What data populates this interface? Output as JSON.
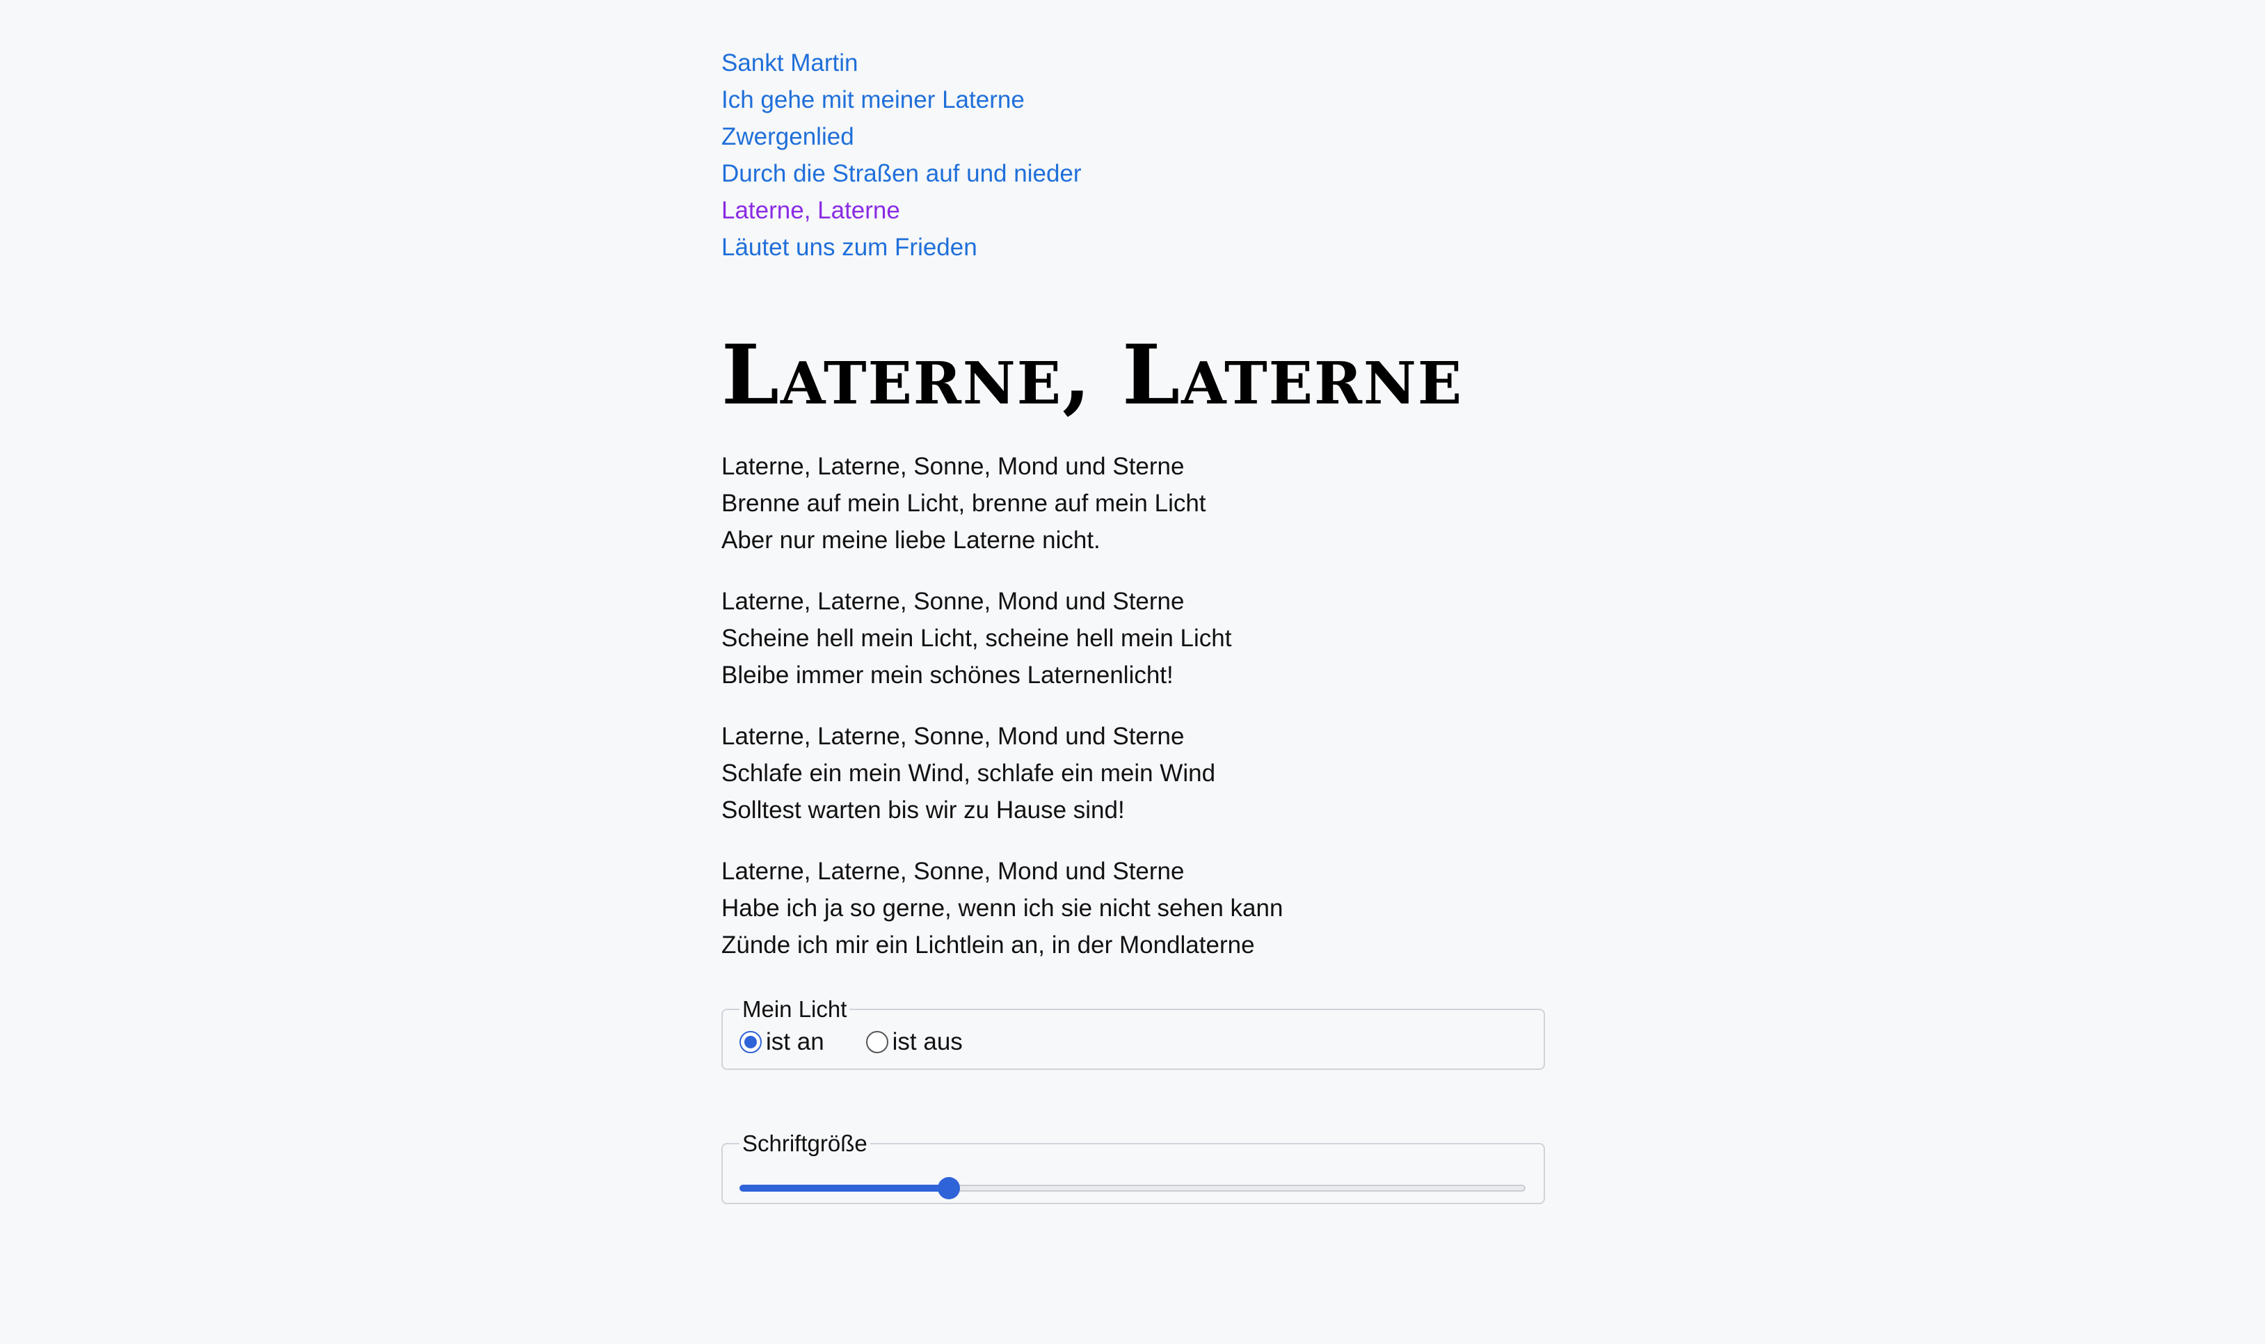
{
  "nav": {
    "items": [
      {
        "label": "Sankt Martin",
        "visited": false
      },
      {
        "label": "Ich gehe mit meiner Laterne",
        "visited": false
      },
      {
        "label": "Zwergenlied",
        "visited": false
      },
      {
        "label": "Durch die Straßen auf und nieder",
        "visited": false
      },
      {
        "label": "Laterne, Laterne",
        "visited": true
      },
      {
        "label": "Läutet uns zum Frieden",
        "visited": false
      }
    ]
  },
  "song": {
    "title": "Laterne, Laterne",
    "verses": [
      [
        "Laterne, Laterne, Sonne, Mond und Sterne",
        "Brenne auf mein Licht, brenne auf mein Licht",
        "Aber nur meine liebe Laterne nicht."
      ],
      [
        "Laterne, Laterne, Sonne, Mond und Sterne",
        "Scheine hell mein Licht, scheine hell mein Licht",
        "Bleibe immer mein schönes Laternenlicht!"
      ],
      [
        "Laterne, Laterne, Sonne, Mond und Sterne",
        "Schlafe ein mein Wind, schlafe ein mein Wind",
        "Solltest warten bis wir zu Hause sind!"
      ],
      [
        "Laterne, Laterne, Sonne, Mond und Sterne",
        "Habe ich ja so gerne, wenn ich sie nicht sehen kann",
        "Zünde ich mir ein Lichtlein an, in der Mondlaterne"
      ]
    ]
  },
  "light": {
    "legend": "Mein Licht",
    "options": [
      {
        "label": "ist an",
        "checked": true
      },
      {
        "label": "ist aus",
        "checked": false
      }
    ]
  },
  "font_size": {
    "legend": "Schriftgröße",
    "value_fraction": 0.26
  },
  "colors": {
    "link": "#1f6fd9",
    "visited_link": "#8a2be2",
    "accent": "#2f63d8",
    "background": "#f7f8fa"
  }
}
